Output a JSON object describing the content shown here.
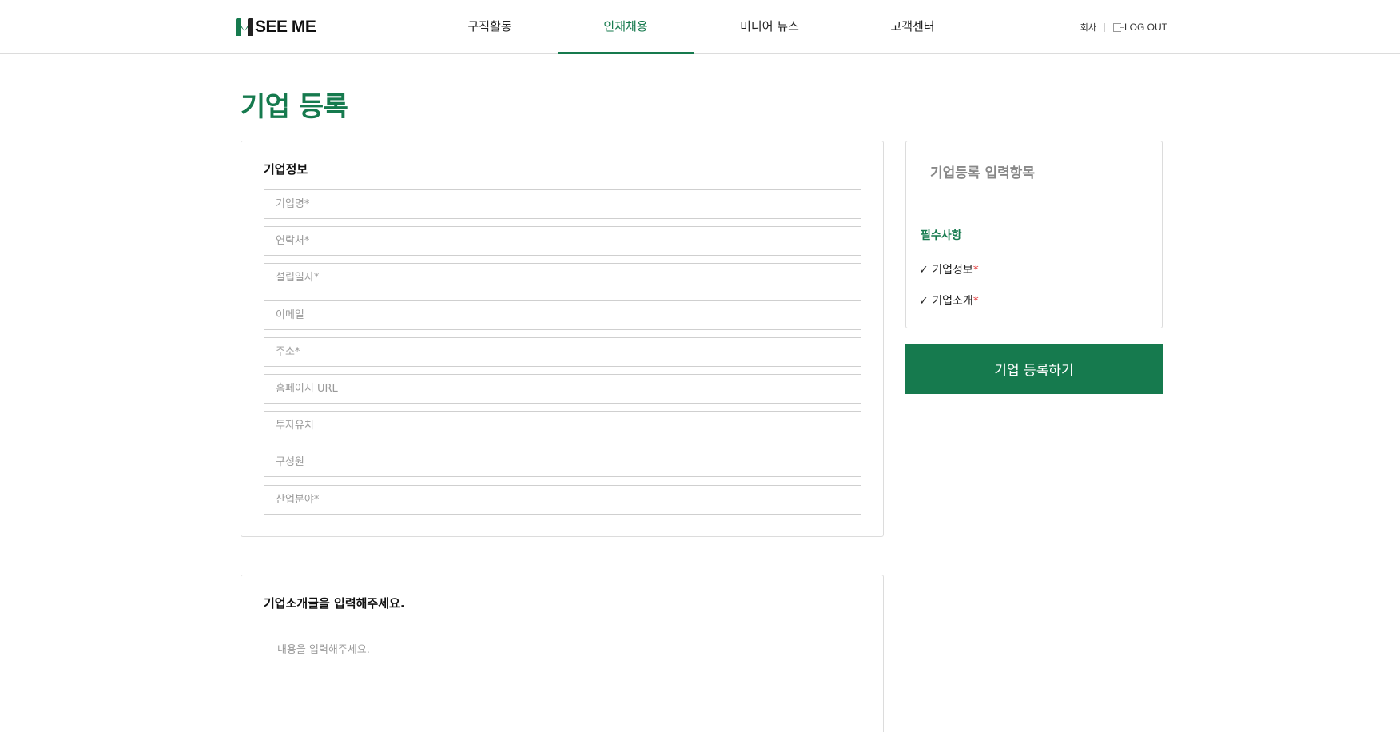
{
  "header": {
    "logo_text": "SEE ME",
    "nav": [
      {
        "label": "구직활동"
      },
      {
        "label": "인재채용"
      },
      {
        "label": "미디어 뉴스"
      },
      {
        "label": "고객센터"
      }
    ],
    "active_nav_index": 1,
    "user_label": "회사",
    "logout_label": "LOG OUT"
  },
  "page": {
    "title": "기업 등록"
  },
  "company_info": {
    "heading": "기업정보",
    "fields": [
      {
        "placeholder": "기업명*",
        "value": ""
      },
      {
        "placeholder": "연락처*",
        "value": ""
      },
      {
        "placeholder": "설립일자*",
        "value": ""
      },
      {
        "placeholder": "이메일",
        "value": ""
      },
      {
        "placeholder": "주소*",
        "value": ""
      },
      {
        "placeholder": "홈페이지 URL",
        "value": ""
      },
      {
        "placeholder": "투자유치",
        "value": ""
      },
      {
        "placeholder": "구성원",
        "value": ""
      },
      {
        "placeholder": "산업분야*",
        "value": ""
      }
    ]
  },
  "company_intro": {
    "heading": "기업소개글을 입력해주세요.",
    "placeholder": "내용을 입력해주세요."
  },
  "sidebar": {
    "title": "기업등록 입력항목",
    "section": "필수사항",
    "items": [
      {
        "check": "✓",
        "label": "기업정보",
        "required_mark": "*"
      },
      {
        "check": "✓",
        "label": "기업소개",
        "required_mark": "*"
      }
    ],
    "submit_label": "기업 등록하기"
  },
  "colors": {
    "brand": "#167a4e",
    "required": "#e03030",
    "border": "#dcdcdc"
  }
}
